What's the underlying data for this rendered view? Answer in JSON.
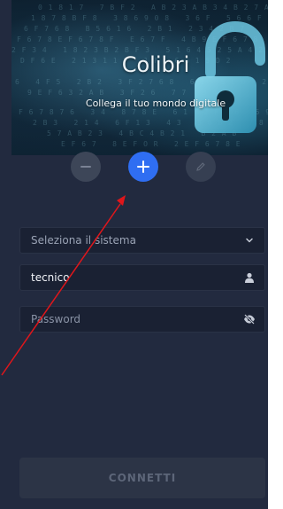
{
  "app": {
    "title": "Colibri",
    "subtitle": "Collega il tuo mondo digitale"
  },
  "actions": {
    "remove_icon": "minus-icon",
    "add_icon": "plus-icon",
    "edit_icon": "pencil-icon"
  },
  "form": {
    "system_select": {
      "placeholder": "Seleziona il sistema",
      "icon": "chevron-down-icon"
    },
    "username": {
      "value": "tecnico",
      "icon": "user-icon"
    },
    "password": {
      "placeholder": "Password",
      "icon": "eye-off-icon"
    },
    "connect_label": "CONNETTI"
  },
  "colors": {
    "background": "#222a3f",
    "accent": "#2f6ef2",
    "annotation": "#e0161b"
  },
  "annotation": {
    "type": "red-arrow",
    "points_to": "add-button"
  }
}
